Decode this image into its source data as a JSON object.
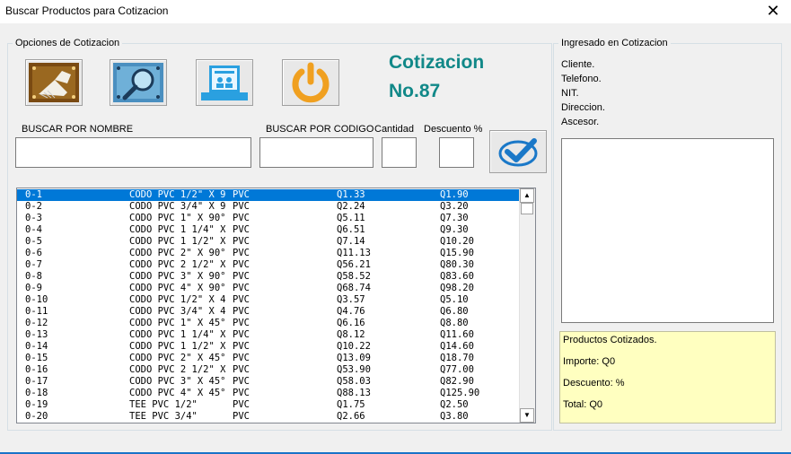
{
  "window": {
    "title": "Buscar Productos para Cotizacion",
    "close_label": "✕"
  },
  "options_group": {
    "legend": "Opciones de Cotizacion"
  },
  "buttons": [
    {
      "name": "clear-button",
      "icon": "broom-icon"
    },
    {
      "name": "search-button",
      "icon": "magnifier-icon"
    },
    {
      "name": "report-button",
      "icon": "document-users-icon"
    },
    {
      "name": "exit-button",
      "icon": "power-icon"
    }
  ],
  "cotizacion": {
    "title": "Cotizacion",
    "number": "No.87",
    "color": "#118888"
  },
  "search": {
    "by_name_label": "BUSCAR POR NOMBRE",
    "by_name_value": "",
    "by_code_label": "BUSCAR POR CODIGO",
    "by_code_value": "",
    "quantity_label": "Cantidad",
    "quantity_value": "",
    "discount_label": "Descuento %",
    "discount_value": ""
  },
  "products": [
    {
      "code": "0-1",
      "name": "CODO PVC 1/2\" X 90",
      "type": "PVC",
      "cost": "Q1.33",
      "price": "Q1.90",
      "selected": true
    },
    {
      "code": "0-2",
      "name": "CODO PVC 3/4\" X 90°",
      "type": "PVC",
      "cost": "Q2.24",
      "price": "Q3.20"
    },
    {
      "code": "0-3",
      "name": "CODO PVC 1\" X 90°",
      "type": "PVC",
      "cost": "Q5.11",
      "price": "Q7.30"
    },
    {
      "code": "0-4",
      "name": "CODO PVC 1 1/4\" X 90",
      "type": "PVC",
      "cost": "Q6.51",
      "price": "Q9.30"
    },
    {
      "code": "0-5",
      "name": "CODO PVC 1 1/2\" X 90",
      "type": "PVC",
      "cost": "Q7.14",
      "price": "Q10.20"
    },
    {
      "code": "0-6",
      "name": "CODO PVC 2\" X 90°",
      "type": "PVC",
      "cost": "Q11.13",
      "price": "Q15.90"
    },
    {
      "code": "0-7",
      "name": "CODO PVC 2 1/2\" X 90",
      "type": "PVC",
      "cost": "Q56.21",
      "price": "Q80.30"
    },
    {
      "code": "0-8",
      "name": "CODO PVC 3\" X 90°",
      "type": "PVC",
      "cost": "Q58.52",
      "price": "Q83.60"
    },
    {
      "code": "0-9",
      "name": "CODO PVC 4\" X 90°",
      "type": "PVC",
      "cost": "Q68.74",
      "price": "Q98.20"
    },
    {
      "code": "0-10",
      "name": "CODO PVC 1/2\" X 45°",
      "type": "PVC",
      "cost": "Q3.57",
      "price": "Q5.10"
    },
    {
      "code": "0-11",
      "name": "CODO PVC 3/4\" X 45°",
      "type": "PVC",
      "cost": "Q4.76",
      "price": "Q6.80"
    },
    {
      "code": "0-12",
      "name": "CODO PVC 1\" X 45°",
      "type": "PVC",
      "cost": "Q6.16",
      "price": "Q8.80"
    },
    {
      "code": "0-13",
      "name": "CODO PVC 1 1/4\" X 45",
      "type": "PVC",
      "cost": "Q8.12",
      "price": "Q11.60"
    },
    {
      "code": "0-14",
      "name": "CODO PVC 1 1/2\" X 45",
      "type": "PVC",
      "cost": "Q10.22",
      "price": "Q14.60"
    },
    {
      "code": "0-15",
      "name": "CODO PVC 2\" X 45°",
      "type": "PVC",
      "cost": "Q13.09",
      "price": "Q18.70"
    },
    {
      "code": "0-16",
      "name": "CODO PVC 2 1/2\" X 45",
      "type": "PVC",
      "cost": "Q53.90",
      "price": "Q77.00"
    },
    {
      "code": "0-17",
      "name": "CODO PVC 3\" X 45°",
      "type": "PVC",
      "cost": "Q58.03",
      "price": "Q82.90"
    },
    {
      "code": "0-18",
      "name": "CODO PVC 4\" X 45°",
      "type": "PVC",
      "cost": "Q88.13",
      "price": "Q125.90"
    },
    {
      "code": "0-19",
      "name": "TEE PVC 1/2\"",
      "type": "PVC",
      "cost": "Q1.75",
      "price": "Q2.50"
    },
    {
      "code": "0-20",
      "name": "TEE PVC 3/4\"",
      "type": "PVC",
      "cost": "Q2.66",
      "price": "Q3.80"
    }
  ],
  "scroll": {
    "up_label": "▲",
    "down_label": "▼"
  },
  "ingresado_group": {
    "legend": "Ingresado en Cotizacion",
    "cliente": "Cliente.",
    "telefono": "Telefono.",
    "nit": "NIT.",
    "direccion": "Direccion.",
    "ascesor": "Ascesor."
  },
  "summary": {
    "productos": "Productos Cotizados.",
    "importe": "Importe: Q0",
    "descuento": "Descuento: %",
    "total": "Total: Q0",
    "background": "#ffffc0"
  }
}
